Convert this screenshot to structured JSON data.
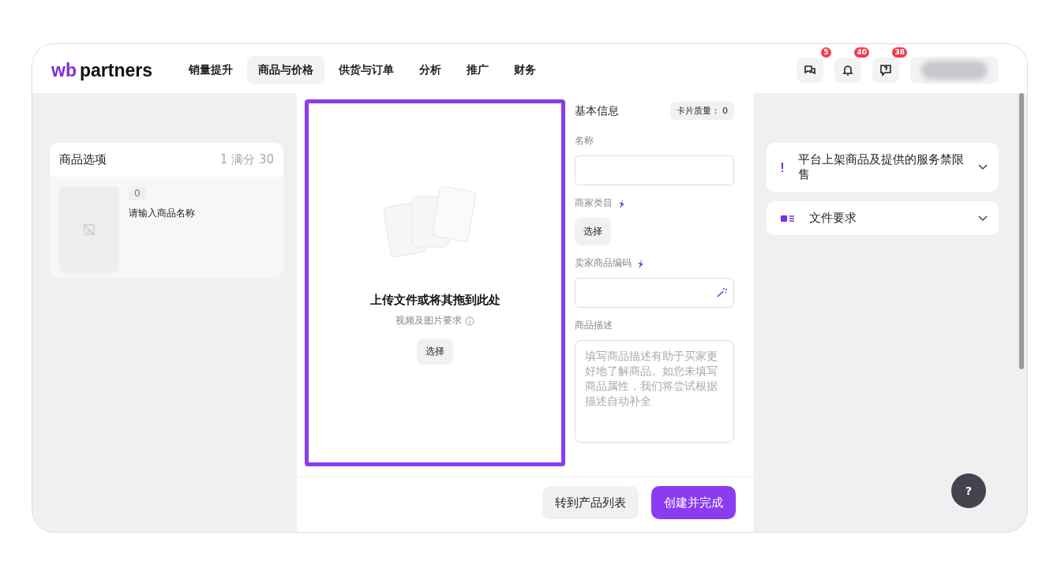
{
  "logo": {
    "brand": "wb",
    "name": "partners"
  },
  "nav": [
    {
      "label": "销量提升",
      "selected": false
    },
    {
      "label": "商品与价格",
      "selected": true
    },
    {
      "label": "供货与订单",
      "selected": false
    },
    {
      "label": "分析",
      "selected": false
    },
    {
      "label": "推广",
      "selected": false
    },
    {
      "label": "财务",
      "selected": false
    }
  ],
  "header_icons": [
    {
      "kind": "chat",
      "badge": "5"
    },
    {
      "kind": "bell",
      "badge": "40"
    },
    {
      "kind": "help",
      "badge": "38"
    }
  ],
  "options_card": {
    "title": "商品选项",
    "count": "1 满分 30",
    "item": {
      "index": "0",
      "name": "请输入商品名称"
    }
  },
  "upload": {
    "title": "上传文件或将其拖到此处",
    "hint": "视频及图片要求",
    "button": "选择"
  },
  "form": {
    "title": "基本信息",
    "quality": "卡片质量：",
    "quality_value": "0",
    "fields": [
      {
        "kind": "input",
        "label": "名称"
      },
      {
        "kind": "button",
        "label": "商家类目",
        "button": "选择"
      },
      {
        "kind": "input-magic",
        "label": "卖家商品编码"
      },
      {
        "kind": "textarea",
        "label": "商品描述",
        "placeholder": "填写商品描述有助于买家更好地了解商品。如您未填写商品属性，我们将尝试根据描述自动补全"
      }
    ]
  },
  "footer_buttons": [
    {
      "kind": "secondary",
      "label": "转到产品列表"
    },
    {
      "kind": "primary",
      "label": "创建并完成"
    }
  ],
  "info_panels": [
    {
      "kind": "warning",
      "title": "平台上架商品及提供的服务禁限售",
      "expanded": false
    },
    {
      "kind": "file",
      "title": "文件要求",
      "expanded": false
    }
  ],
  "help_button": "?"
}
